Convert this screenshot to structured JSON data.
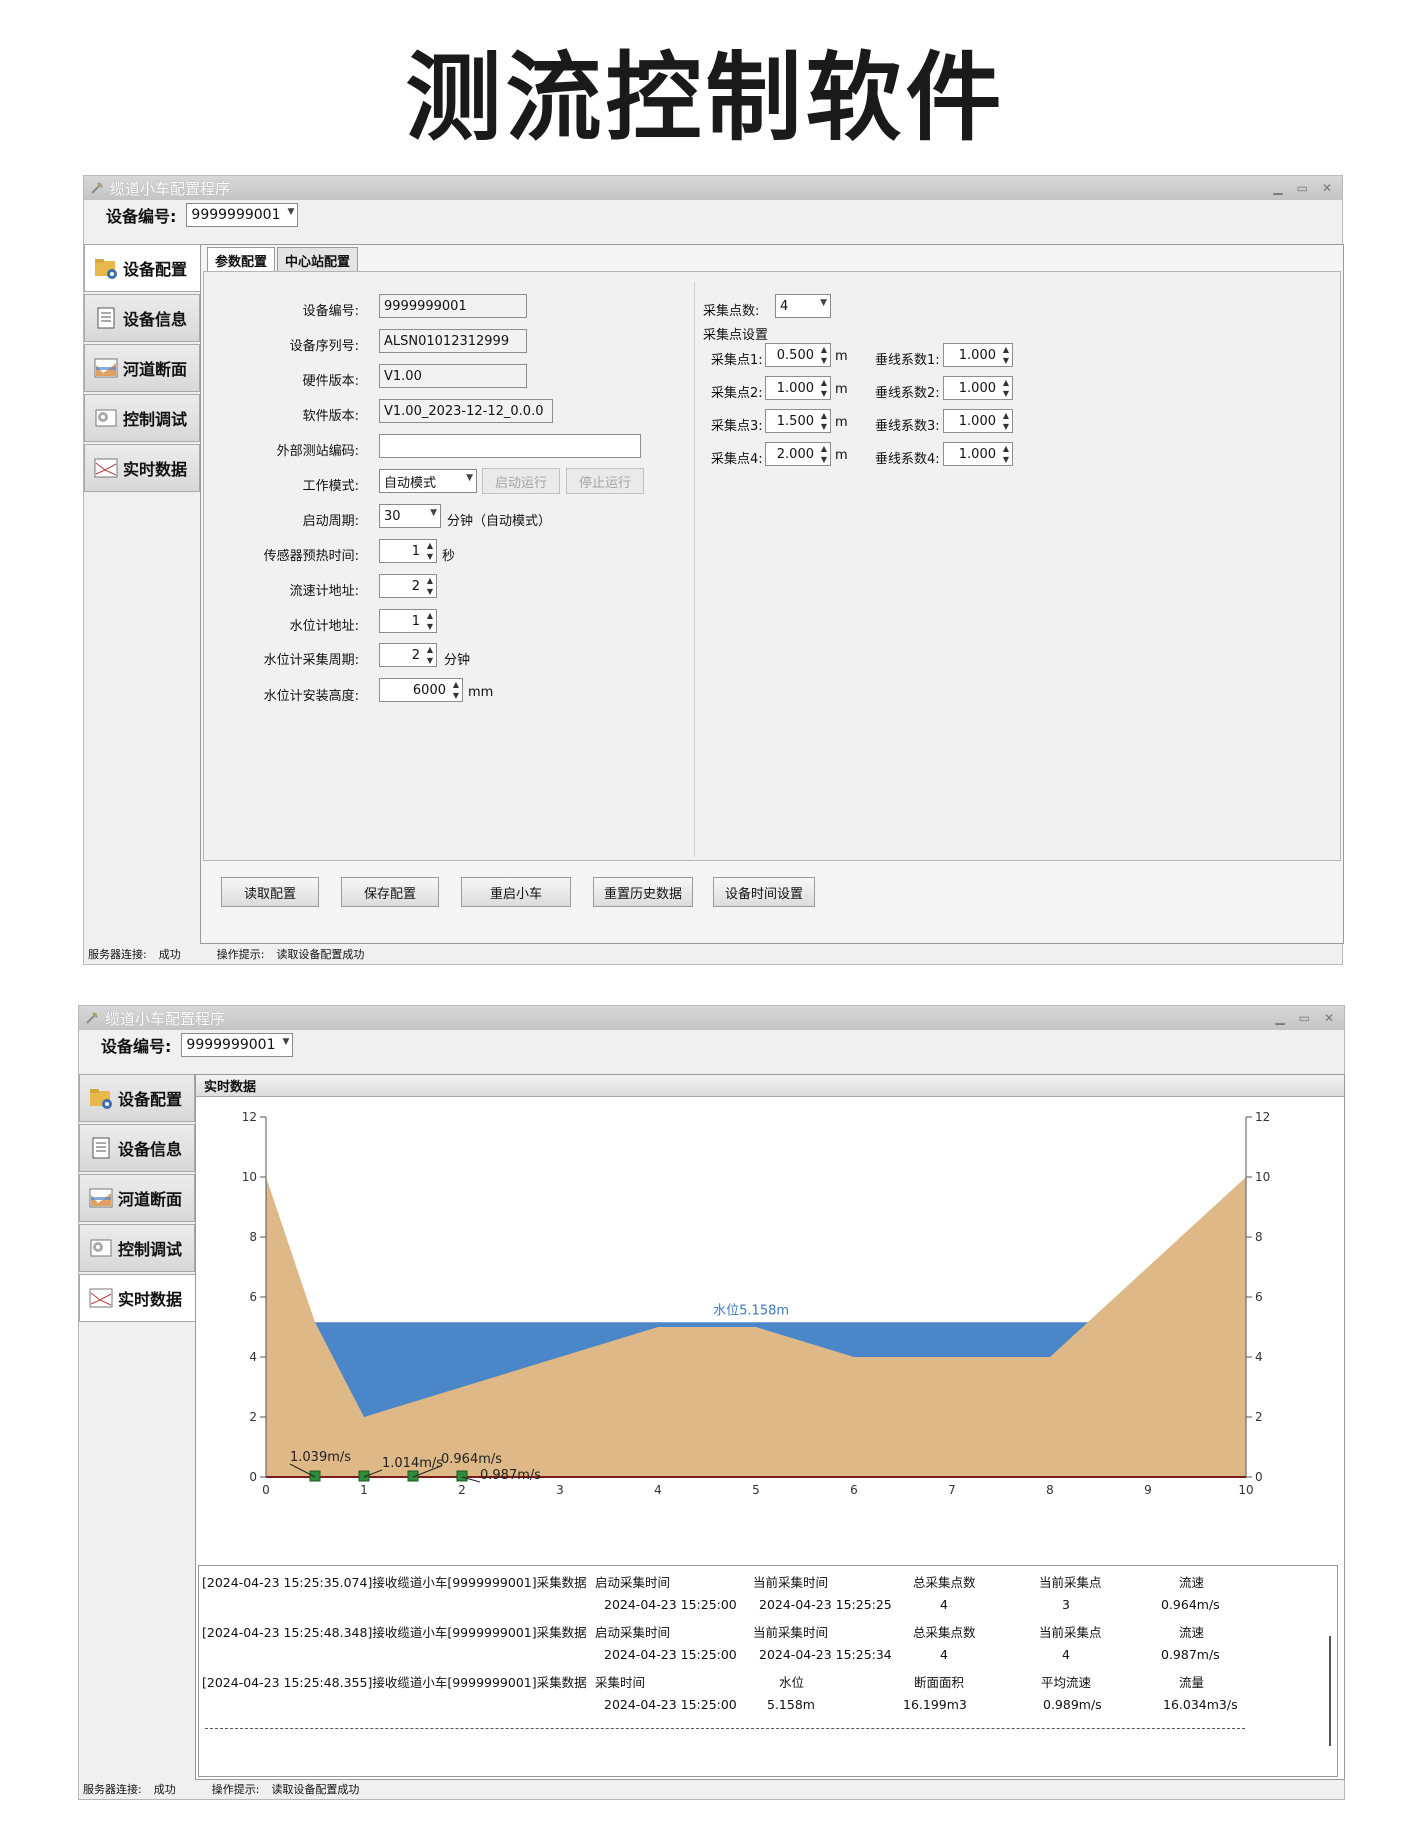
{
  "page_title": "测流控制软件",
  "window_title": "缆道小车配置程序",
  "device_label": "设备编号:",
  "device_value": "9999999001",
  "side_tabs": [
    "设备配置",
    "设备信息",
    "河道断面",
    "控制调试",
    "实时数据"
  ],
  "config": {
    "tabs": [
      "参数配置",
      "中心站配置"
    ],
    "fields": {
      "device_no": {
        "label": "设备编号:",
        "value": "9999999001"
      },
      "serial": {
        "label": "设备序列号:",
        "value": "ALSN01012312999"
      },
      "hw": {
        "label": "硬件版本:",
        "value": "V1.00"
      },
      "sw": {
        "label": "软件版本:",
        "value": "V1.00_2023-12-12_0.0.0"
      },
      "ext_code": {
        "label": "外部测站编码:",
        "value": ""
      },
      "mode": {
        "label": "工作模式:",
        "value": "自动模式"
      },
      "start_btn": "启动运行",
      "stop_btn": "停止运行",
      "period": {
        "label": "启动周期:",
        "value": "30",
        "unit": "分钟（自动模式）"
      },
      "preheat": {
        "label": "传感器预热时间:",
        "value": "1",
        "unit": "秒"
      },
      "flow_addr": {
        "label": "流速计地址:",
        "value": "2"
      },
      "level_addr": {
        "label": "水位计地址:",
        "value": "1"
      },
      "level_period": {
        "label": "水位计采集周期:",
        "value": "2",
        "unit": "分钟"
      },
      "level_height": {
        "label": "水位计安装高度:",
        "value": "6000",
        "unit": "mm"
      }
    },
    "points_count": {
      "label": "采集点数:",
      "value": "4"
    },
    "points_group": "采集点设置",
    "points": [
      {
        "label": "采集点1:",
        "value": "0.500",
        "unit": "m",
        "coef_label": "垂线系数1:",
        "coef": "1.000"
      },
      {
        "label": "采集点2:",
        "value": "1.000",
        "unit": "m",
        "coef_label": "垂线系数2:",
        "coef": "1.000"
      },
      {
        "label": "采集点3:",
        "value": "1.500",
        "unit": "m",
        "coef_label": "垂线系数3:",
        "coef": "1.000"
      },
      {
        "label": "采集点4:",
        "value": "2.000",
        "unit": "m",
        "coef_label": "垂线系数4:",
        "coef": "1.000"
      }
    ],
    "buttons": [
      "读取配置",
      "保存配置",
      "重启小车",
      "重置历史数据",
      "设备时间设置"
    ]
  },
  "status": {
    "conn_label": "服务器连接:",
    "conn_value": "成功",
    "tip_label": "操作提示:",
    "tip_value": "读取设备配置成功"
  },
  "realtime": {
    "header": "实时数据",
    "log": [
      {
        "text": "[2024-04-23 15:25:35.074]接收缆道小车[9999999001]采集数据",
        "cols": [
          "启动采集时间",
          "当前采集时间",
          "总采集点数",
          "当前采集点",
          "流速"
        ],
        "vals": [
          "2024-04-23 15:25:00",
          "2024-04-23 15:25:25",
          "4",
          "3",
          "0.964m/s"
        ]
      },
      {
        "text": "[2024-04-23 15:25:48.348]接收缆道小车[9999999001]采集数据",
        "cols": [
          "启动采集时间",
          "当前采集时间",
          "总采集点数",
          "当前采集点",
          "流速"
        ],
        "vals": [
          "2024-04-23 15:25:00",
          "2024-04-23 15:25:34",
          "4",
          "4",
          "0.987m/s"
        ]
      },
      {
        "text": "[2024-04-23 15:25:48.355]接收缆道小车[9999999001]采集数据",
        "cols": [
          "采集时间",
          "水位",
          "断面面积",
          "平均流速",
          "流量"
        ],
        "vals": [
          "2024-04-23 15:25:00",
          "5.158m",
          "16.199m3",
          "0.989m/s",
          "16.034m3/s"
        ]
      }
    ]
  },
  "chart_data": {
    "type": "area",
    "title": "",
    "xlabel": "",
    "ylabel": "",
    "xlim": [
      0,
      10
    ],
    "ylim": [
      0,
      12
    ],
    "xticks": [
      0,
      1,
      2,
      3,
      4,
      5,
      6,
      7,
      8,
      9,
      10
    ],
    "yticks": [
      0,
      2,
      4,
      6,
      8,
      10,
      12
    ],
    "riverbed": {
      "x": [
        0,
        0.5,
        1,
        4,
        5,
        6,
        8,
        10
      ],
      "y": [
        10,
        5.158,
        2,
        5,
        5,
        4,
        4,
        10
      ]
    },
    "water_level": 5.158,
    "water_label": "水位5.158m",
    "water_color": "#4a86c8",
    "bed_color": "#deb887",
    "measure_points": [
      0.5,
      1.0,
      1.5,
      2.0
    ],
    "velocity_labels": [
      {
        "x": 0.5,
        "text": "1.039m/s"
      },
      {
        "x": 1.0,
        "text": "1.014m/s"
      },
      {
        "x": 1.5,
        "text": "0.964m/s"
      },
      {
        "x": 2.0,
        "text": "0.987m/s"
      }
    ]
  }
}
